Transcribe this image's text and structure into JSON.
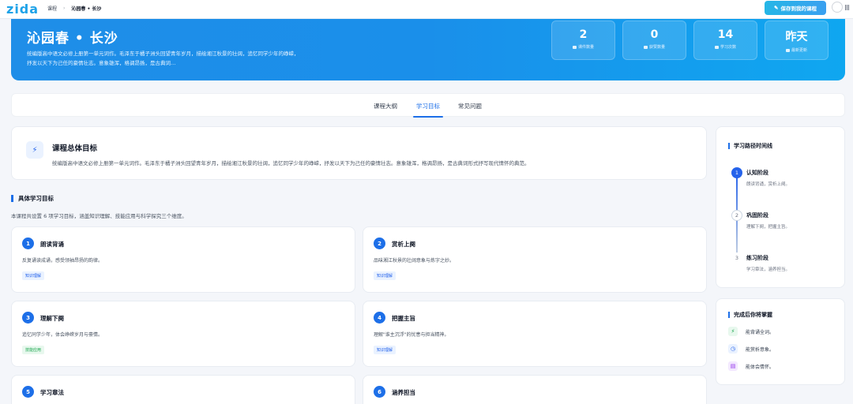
{
  "topbar": {
    "logo": "zida",
    "breadcrumb": [
      "课程",
      "沁园春 • 长沙"
    ],
    "save_label": "保存到我的课程"
  },
  "hero": {
    "title": "沁园春 • 长沙",
    "description": "统编版高中语文必修上册第一单元词作。毛泽东于橘子洲头回望青年岁月，描绘湘江秋景的壮阔，追忆同学少年的峥嵘，抒发以天下为己任的豪情壮志。意象雄浑，格调昂扬，是古典词…",
    "stats": [
      {
        "value": "2",
        "label": "课件数量",
        "icon": "folder-icon"
      },
      {
        "value": "0",
        "label": "获赞数量",
        "icon": "heart-icon"
      },
      {
        "value": "14",
        "label": "学习次数",
        "icon": "user-icon"
      },
      {
        "value": "昨天",
        "label": "最新更新",
        "icon": "refresh-icon"
      }
    ]
  },
  "tabs": [
    {
      "label": "课程大纲",
      "active": false
    },
    {
      "label": "学习目标",
      "active": true
    },
    {
      "label": "常见问题",
      "active": false
    }
  ],
  "overview": {
    "icon": "lightning-icon",
    "title": "课程总体目标",
    "text": "统编版高中语文必修上册第一单元词作。毛泽东于橘子洲头回望青年岁月，描绘湘江秋景的壮阔，追忆同学少年的峥嵘，抒发以天下为己任的豪情壮志。意象雄浑，格调昂扬，是古典词形式抒写现代情怀的典范。"
  },
  "goals_section": {
    "title": "具体学习目标",
    "subtitle": "本课程共设置 6 项学习目标，涵盖知识理解、技能应用与科学探究三个维度。"
  },
  "goals": [
    {
      "num": "1",
      "title": "朗读背诵",
      "desc": "反复诵读成诵，感受领袖昂扬的韵律。",
      "tag": "知识理解",
      "tag_color": "blue"
    },
    {
      "num": "2",
      "title": "赏析上阕",
      "desc": "品味湘江秋景的壮阔意象与炼字之妙。",
      "tag": "知识理解",
      "tag_color": "blue"
    },
    {
      "num": "3",
      "title": "理解下阕",
      "desc": "追忆同学少年，体会峥嵘岁月与豪情。",
      "tag": "技能应用",
      "tag_color": "green"
    },
    {
      "num": "4",
      "title": "把握主旨",
      "desc": "理解\"谁主沉浮\"的忧患与担当精神。",
      "tag": "知识理解",
      "tag_color": "blue"
    },
    {
      "num": "5",
      "title": "学习章法",
      "desc": "",
      "tag": "",
      "tag_color": ""
    },
    {
      "num": "6",
      "title": "涵养担当",
      "desc": "",
      "tag": "",
      "tag_color": ""
    }
  ],
  "timeline": {
    "title": "学习路径时间线",
    "steps": [
      {
        "num": "1",
        "title": "认知阶段",
        "desc": "朗读背诵，赏析上阕。",
        "active": true
      },
      {
        "num": "2",
        "title": "巩固阶段",
        "desc": "理解下阕，把握主旨。",
        "active": false
      },
      {
        "num": "3",
        "title": "练习阶段",
        "desc": "学习章法，涵养担当。",
        "active": false
      }
    ]
  },
  "mastery": {
    "title": "完成后你将掌握",
    "items": [
      {
        "text": "能背诵全词。",
        "icon": "lightning-icon",
        "color": "#16a34a",
        "bg": "#e8f8ee"
      },
      {
        "text": "能赏析意象。",
        "icon": "clock-icon",
        "color": "#2563eb",
        "bg": "#eaf2ff"
      },
      {
        "text": "能体会情怀。",
        "icon": "clipboard-icon",
        "color": "#9333ea",
        "bg": "#f3e8ff"
      }
    ]
  },
  "colors": {
    "accent": "#1d6fe8",
    "hero_start": "#1f8ee8",
    "hero_end": "#0fa7f0"
  }
}
